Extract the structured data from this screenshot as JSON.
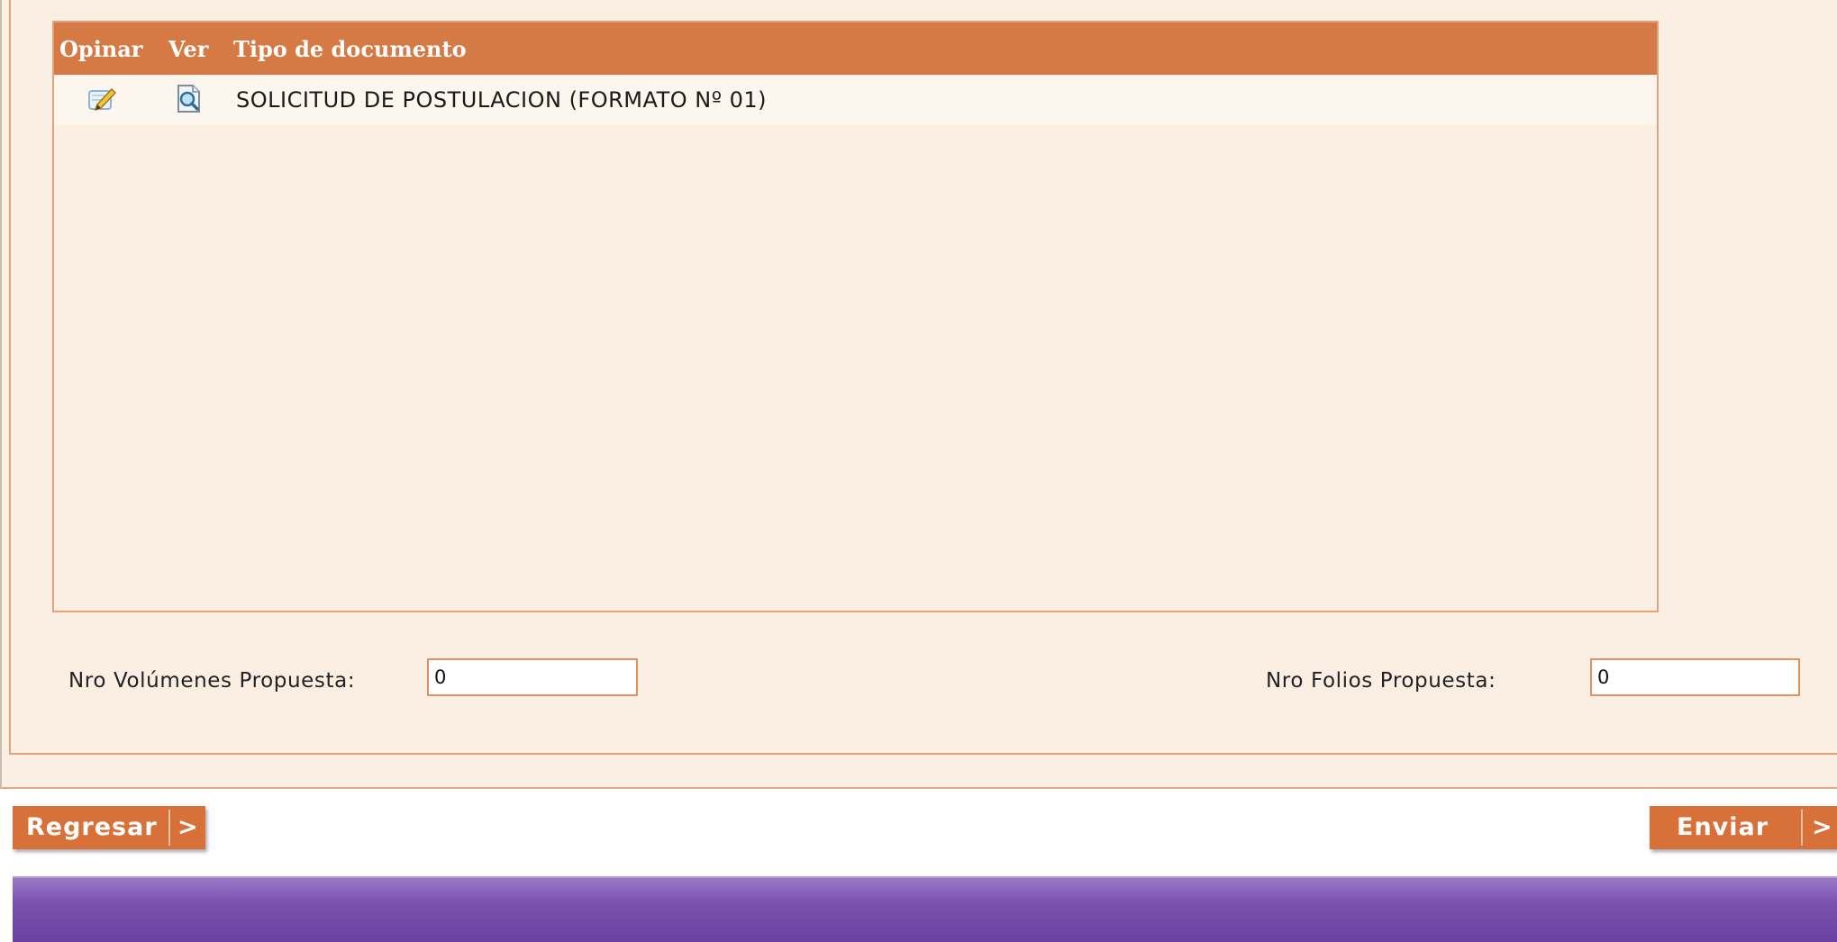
{
  "grid": {
    "columns": {
      "opinar": "Opinar",
      "ver": "Ver",
      "tipo": "Tipo de documento"
    },
    "rows": [
      {
        "tipo_documento": "SOLICITUD DE POSTULACION (FORMATO Nº 01)",
        "edit_icon": "edit-pencil-icon",
        "view_icon": "magnifier-document-icon"
      }
    ]
  },
  "fields": {
    "volumenes": {
      "label": "Nro Volúmenes Propuesta:",
      "value": "0"
    },
    "folios": {
      "label": "Nro Folios Propuesta:",
      "value": "0"
    }
  },
  "buttons": {
    "regresar": {
      "label": "Regresar",
      "arrow": ">"
    },
    "enviar": {
      "label": "Enviar",
      "arrow": ">"
    }
  },
  "colors": {
    "header": "#d57a45",
    "panel": "#fbeee2",
    "border": "#e3a27a",
    "button": "#d8703a",
    "footer": "#7a51ad"
  }
}
